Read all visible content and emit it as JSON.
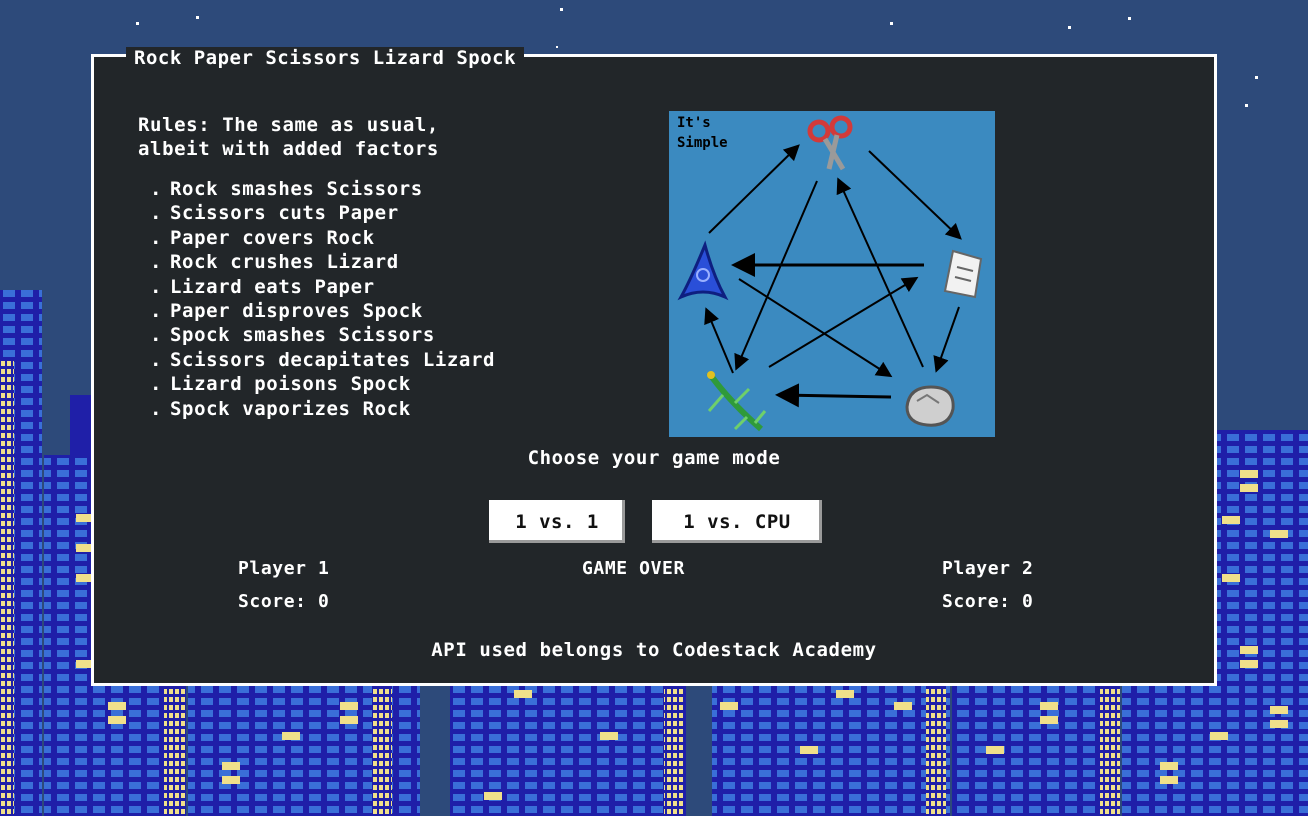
{
  "window": {
    "title": "Rock Paper Scissors Lizard Spock"
  },
  "rules": {
    "intro_line1": "Rules: The same as usual,",
    "intro_line2": "albeit with added factors",
    "items": [
      "Rock smashes Scissors",
      "Scissors cuts Paper",
      "Paper covers Rock",
      "Rock crushes Lizard",
      "Lizard eats Paper",
      "Paper disproves Spock",
      "Spock smashes Scissors",
      "Scissors decapitates Lizard",
      "Lizard poisons Spock",
      "Spock vaporizes Rock"
    ]
  },
  "diagram": {
    "caption_line1": "It's",
    "caption_line2": "Simple"
  },
  "mode": {
    "prompt": "Choose your game mode",
    "btn_1v1": "1 vs. 1",
    "btn_1vcpu": "1 vs. CPU"
  },
  "score": {
    "player1": "Player 1",
    "player1_score": "Score: 0",
    "status": "GAME OVER",
    "player2": "Player 2",
    "player2_score": "Score: 0"
  },
  "footer": {
    "credit": "API used belongs to Codestack Academy"
  },
  "colors": {
    "sky": "#2d4a7a",
    "building": "#1f1fa8",
    "window_lit": "#f0e08a",
    "panel": "#222629",
    "diagram_bg": "#3b8ac0"
  }
}
